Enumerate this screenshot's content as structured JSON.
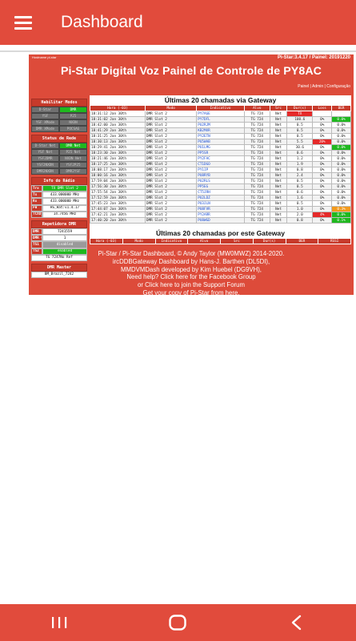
{
  "app": {
    "title": "Dashboard",
    "menu_icon": "hamburger-icon"
  },
  "panel": {
    "small_label": "Hostname pi-star",
    "version": "Pi-Star:3.4.17 / Painel: 20191220",
    "title": "Pi-Star Digital Voz Painel de Controle de PY8AC",
    "links": [
      "Painel",
      "Admin",
      "Configuração"
    ]
  },
  "modes": {
    "title": "Habilitar Modos",
    "items": [
      {
        "label": "D-Star",
        "on": false
      },
      {
        "label": "DMR",
        "on": true
      },
      {
        "label": "YSF",
        "on": false
      },
      {
        "label": "P25",
        "on": false
      },
      {
        "label": "YSF XMode",
        "on": false
      },
      {
        "label": "NXDN",
        "on": false
      },
      {
        "label": "DMR XMode",
        "on": false
      },
      {
        "label": "POCSAG",
        "on": false
      }
    ]
  },
  "network": {
    "title": "Status de Rede",
    "items": [
      {
        "label": "D-Star Net",
        "on": false
      },
      {
        "label": "DMR Net",
        "on": true
      },
      {
        "label": "YSF Net",
        "on": false
      },
      {
        "label": "P25 Net",
        "on": false
      },
      {
        "label": "YSF2DMR",
        "on": false
      },
      {
        "label": "NXDN Net",
        "on": false
      },
      {
        "label": "YSF2NXDN",
        "on": false
      },
      {
        "label": "YSF2P25",
        "on": false
      },
      {
        "label": "DMR2NXDN",
        "on": false
      },
      {
        "label": "DMR2YSF",
        "on": false
      }
    ]
  },
  "radio": {
    "title": "Info do Rádio",
    "rows": [
      {
        "k": "Trx",
        "v": "TX DMR Slot 2",
        "style": "green"
      },
      {
        "k": "Tx",
        "v": "433.000000 MHz",
        "style": ""
      },
      {
        "k": "Rx",
        "v": "433.000000 MHz",
        "style": ""
      },
      {
        "k": "FW",
        "v": "HS_Hat:v1.4.17",
        "style": ""
      },
      {
        "k": "TCXO",
        "v": "14.7456 MHz",
        "style": ""
      }
    ]
  },
  "dmr_repeater": {
    "title": "Repetidora DMR",
    "rows": [
      {
        "k": "DMR ID",
        "v": "7241559",
        "style": ""
      },
      {
        "k": "DMR CC",
        "v": "1",
        "style": ""
      },
      {
        "k": "TS1",
        "v": "disabled",
        "style": "grey"
      },
      {
        "k": "TS2",
        "v": "enabled",
        "style": "green"
      }
    ],
    "tg": "TG 7247No Ref"
  },
  "dmr_master": {
    "title": "DMR Master",
    "value": "BM_Brazil_7242"
  },
  "gateway": {
    "title": "Últimas 20 chamadas via Gateway",
    "headers": [
      "Hora (-03)",
      "Modo",
      "Indicativo",
      "Alvo",
      "Src",
      "Dur(s)",
      "Loss",
      "BER"
    ],
    "rows": [
      [
        "18:31:12 Jan 30th",
        "DMR Slot 2",
        "PY7AGE",
        "TG 724",
        "Net",
        "TX",
        "",
        ""
      ],
      [
        "18:31:02 Jan 30th",
        "DMR Slot 2",
        "PY7DFL",
        "TG 724",
        "Net",
        "100.6",
        "0%",
        "0.0%"
      ],
      [
        "18:42:00 Jan 30th",
        "DMR Slot 2",
        "PU2RJM",
        "TG 724",
        "Net",
        "0.5",
        "0%",
        "0.0%"
      ],
      [
        "18:41:29 Jan 30th",
        "DMR Slot 2",
        "KB2MXR",
        "TG 724",
        "Net",
        "0.5",
        "0%",
        "0.0%"
      ],
      [
        "18:31:25 Jan 30th",
        "DMR Slot 2",
        "PY2ETN",
        "TG 724",
        "Net",
        "0.5",
        "0%",
        "0.0%"
      ],
      [
        "18:30:13 Jan 30th",
        "DMR Slot 2",
        "PU5WAB",
        "TG 724",
        "Net",
        "5.5",
        "20%",
        "0.0%"
      ],
      [
        "18:29:41 Jan 30th",
        "DMR Slot 2",
        "PU1LMG",
        "TG 724",
        "Net",
        "30.6",
        "0%",
        "0.0%"
      ],
      [
        "18:23:30 Jan 30th",
        "DMR Slot 2",
        "PP5SR",
        "TG 724",
        "Net",
        "0.6",
        "0%",
        "0.0%"
      ],
      [
        "18:21:46 Jan 30th",
        "DMR Slot 2",
        "PY2FAC",
        "TG 724",
        "Net",
        "1.2",
        "0%",
        "0.0%"
      ],
      [
        "18:17:25 Jan 30th",
        "DMR Slot 2",
        "CT1DGO",
        "TG 724",
        "Net",
        "1.9",
        "0%",
        "0.0%"
      ],
      [
        "18:08:17 Jan 30th",
        "DMR Slot 2",
        "PY1IP",
        "TG 724",
        "Net",
        "0.8",
        "0%",
        "0.0%"
      ],
      [
        "18:00:16 Jan 30th",
        "DMR Slot 2",
        "PU8RYB",
        "TG 724",
        "Net",
        "2.4",
        "0%",
        "0.0%"
      ],
      [
        "17:59:04 Jan 30th",
        "DMR Slot 2",
        "PU2RLS",
        "TG 724",
        "Net",
        "0.5",
        "0%",
        "0.0%"
      ],
      [
        "17:56:30 Jan 30th",
        "DMR Slot 2",
        "PP5EG",
        "TG 724",
        "Net",
        "0.5",
        "0%",
        "0.0%"
      ],
      [
        "17:55:54 Jan 30th",
        "DMR Slot 2",
        "CT5JRH",
        "TG 724",
        "Net",
        "0.6",
        "0%",
        "0.0%"
      ],
      [
        "17:52:59 Jan 30th",
        "DMR Slot 2",
        "PU2LDZ",
        "TG 724",
        "Net",
        "1.6",
        "0%",
        "0.0%"
      ],
      [
        "17:45:23 Jan 30th",
        "DMR Slot 2",
        "PU3JLN",
        "TG 724",
        "Net",
        "0.5",
        "0%",
        "0.0%"
      ],
      [
        "17:44:07 Jan 30th",
        "DMR Slot 2",
        "PU8FVR",
        "TG 724",
        "Net",
        "1.0",
        "0%",
        "0.3%"
      ],
      [
        "17:42:21 Jan 30th",
        "DMR Slot 2",
        "PY2ARR",
        "TG 724",
        "Net",
        "2.0",
        "4%",
        "0.0%"
      ],
      [
        "17:40:20 Jan 30th",
        "DMR Slot 2",
        "PU8WGD",
        "TG 724",
        "Net",
        "0.8",
        "0%",
        "0.1%"
      ]
    ],
    "styles": [
      [
        "",
        "",
        "",
        "",
        "",
        "red",
        "",
        ""
      ],
      [
        "",
        "",
        "",
        "",
        "",
        "",
        "",
        "green"
      ],
      [
        "",
        "",
        "",
        "",
        "",
        "",
        "",
        ""
      ],
      [
        "",
        "",
        "",
        "",
        "",
        "",
        "",
        ""
      ],
      [
        "",
        "",
        "",
        "",
        "",
        "",
        "",
        ""
      ],
      [
        "",
        "",
        "",
        "",
        "",
        "",
        "red",
        ""
      ],
      [
        "",
        "",
        "",
        "",
        "",
        "",
        "",
        "green"
      ],
      [
        "",
        "",
        "",
        "",
        "",
        "",
        "",
        ""
      ],
      [
        "",
        "",
        "",
        "",
        "",
        "",
        "",
        ""
      ],
      [
        "",
        "",
        "",
        "",
        "",
        "",
        "",
        ""
      ],
      [
        "",
        "",
        "",
        "",
        "",
        "",
        "",
        ""
      ],
      [
        "",
        "",
        "",
        "",
        "",
        "",
        "",
        ""
      ],
      [
        "",
        "",
        "",
        "",
        "",
        "",
        "",
        ""
      ],
      [
        "",
        "",
        "",
        "",
        "",
        "",
        "",
        ""
      ],
      [
        "",
        "",
        "",
        "",
        "",
        "",
        "",
        ""
      ],
      [
        "",
        "",
        "",
        "",
        "",
        "",
        "",
        ""
      ],
      [
        "",
        "",
        "",
        "",
        "",
        "",
        "",
        ""
      ],
      [
        "",
        "",
        "",
        "",
        "",
        "",
        "",
        "orange"
      ],
      [
        "",
        "",
        "",
        "",
        "",
        "",
        "red",
        "green"
      ],
      [
        "",
        "",
        "",
        "",
        "",
        "",
        "",
        "green"
      ]
    ]
  },
  "local": {
    "title": "Últimas 20 chamadas por este Gateway",
    "headers": [
      "Hora (-03)",
      "Modo",
      "Indicativo",
      "Alvo",
      "Src",
      "Dur(s)",
      "BER",
      "RSSI"
    ]
  },
  "footer": {
    "lines": [
      "Pi-Star / Pi-Star Dashboard, © Andy Taylor (MW0MWZ) 2014-2020.",
      "ircDDBGateway Dashboard by Hans-J. Barthen (DL5DI),",
      "MMDVMDash developed by Kim Huebel (DG9VH),",
      "Need help? Click here for the Facebook Group",
      "or Click here to join the Support Forum",
      "Get your copy of Pi-Star from here."
    ]
  },
  "nav": {
    "recent_icon": "recent-apps-icon",
    "home_icon": "home-icon",
    "back_icon": "back-icon"
  },
  "colors": {
    "accent": "#e14b3c",
    "header_cell": "#c73a2b",
    "on": "#1fb81f",
    "off": "#666666",
    "alert": "#e52a2a"
  }
}
